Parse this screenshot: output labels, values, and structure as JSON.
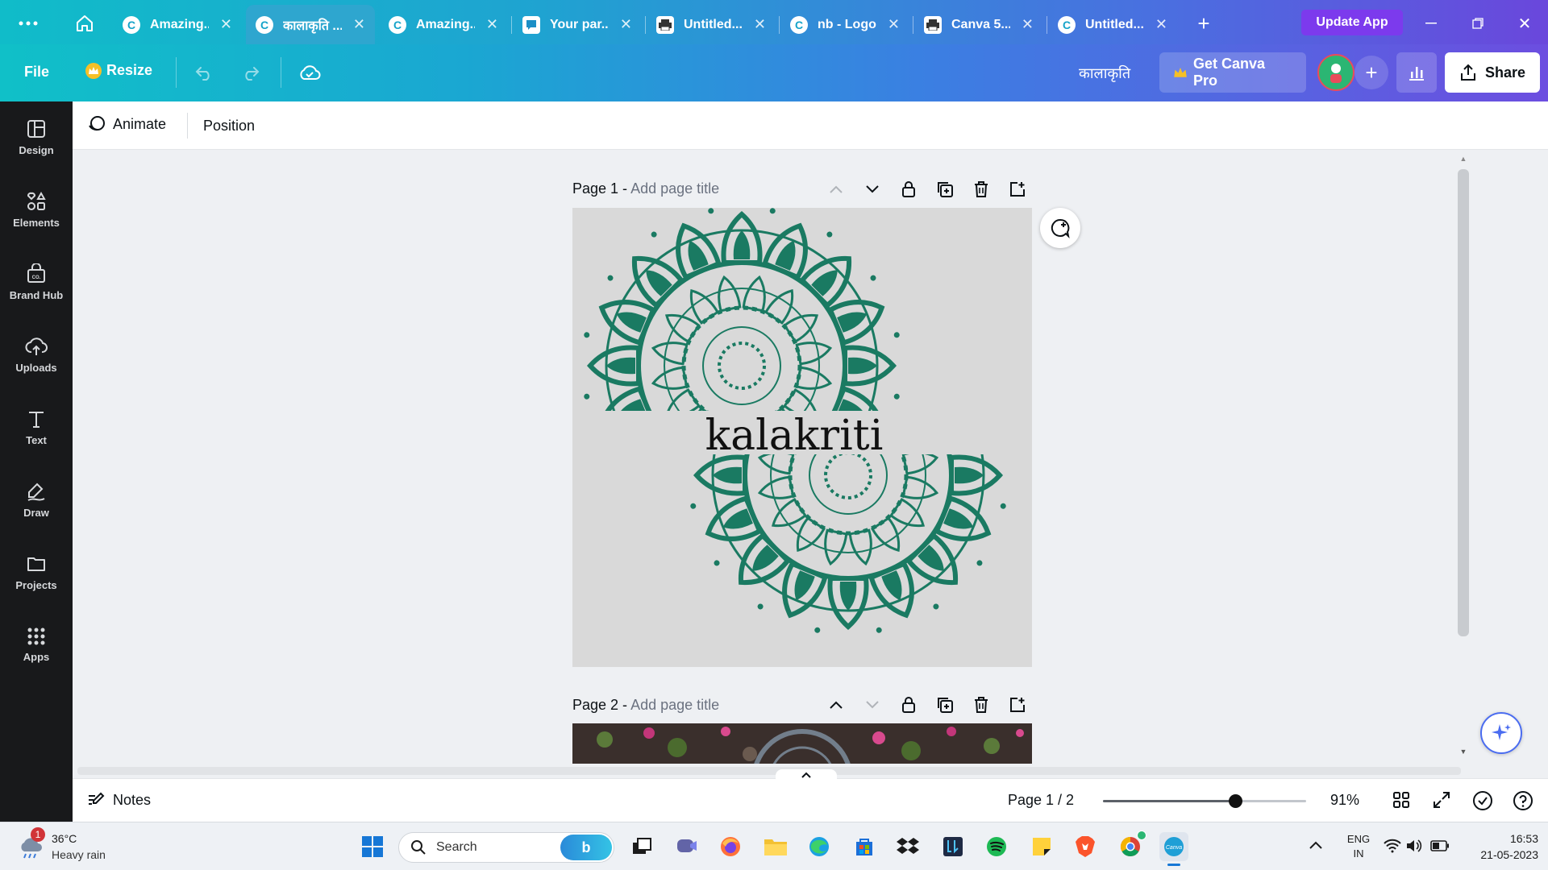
{
  "browser": {
    "tabs": [
      {
        "label": "Amazing...",
        "icon": "canva-icon",
        "active": false
      },
      {
        "label": "कालाकृति ...",
        "icon": "canva-icon",
        "active": true
      },
      {
        "label": "Amazing...",
        "icon": "canva-icon",
        "active": false
      },
      {
        "label": "Your par...",
        "icon": "chat-icon",
        "active": false
      },
      {
        "label": "Untitled...",
        "icon": "print-icon",
        "active": false
      },
      {
        "label": "nb - Logo",
        "icon": "canva-icon",
        "active": false
      },
      {
        "label": "Canva 5...",
        "icon": "print-icon",
        "active": false
      },
      {
        "label": "Untitled...",
        "icon": "canva-icon",
        "active": false
      }
    ],
    "update_button": "Update App"
  },
  "toolbar": {
    "file": "File",
    "resize": "Resize",
    "doc_title": "कालाकृति",
    "get_pro": "Get Canva Pro",
    "share": "Share"
  },
  "sidebar": {
    "items": [
      {
        "label": "Design",
        "icon": "design-icon"
      },
      {
        "label": "Elements",
        "icon": "elements-icon"
      },
      {
        "label": "Brand Hub",
        "icon": "brand-hub-icon"
      },
      {
        "label": "Uploads",
        "icon": "upload-cloud-icon"
      },
      {
        "label": "Text",
        "icon": "text-icon"
      },
      {
        "label": "Draw",
        "icon": "draw-icon"
      },
      {
        "label": "Projects",
        "icon": "folder-icon"
      },
      {
        "label": "Apps",
        "icon": "apps-grid-icon"
      }
    ]
  },
  "context": {
    "animate": "Animate",
    "position": "Position"
  },
  "pages": [
    {
      "label": "Page 1 -",
      "title_placeholder": "Add page title"
    },
    {
      "label": "Page 2 -",
      "title_placeholder": "Add page title"
    }
  ],
  "design": {
    "wordmark": "kalakriti",
    "mandala_color": "#1a7a62",
    "page_bg": "#d9d9d9"
  },
  "bottom": {
    "notes": "Notes",
    "page_indicator": "Page 1 / 2",
    "zoom_level": 0.65,
    "zoom_percent": "91%"
  },
  "taskbar": {
    "weather_temp": "36°C",
    "weather_desc": "Heavy rain",
    "weather_badge": "1",
    "search": "Search",
    "lang_top": "ENG",
    "lang_bottom": "IN",
    "time": "16:53",
    "date": "21-05-2023"
  }
}
